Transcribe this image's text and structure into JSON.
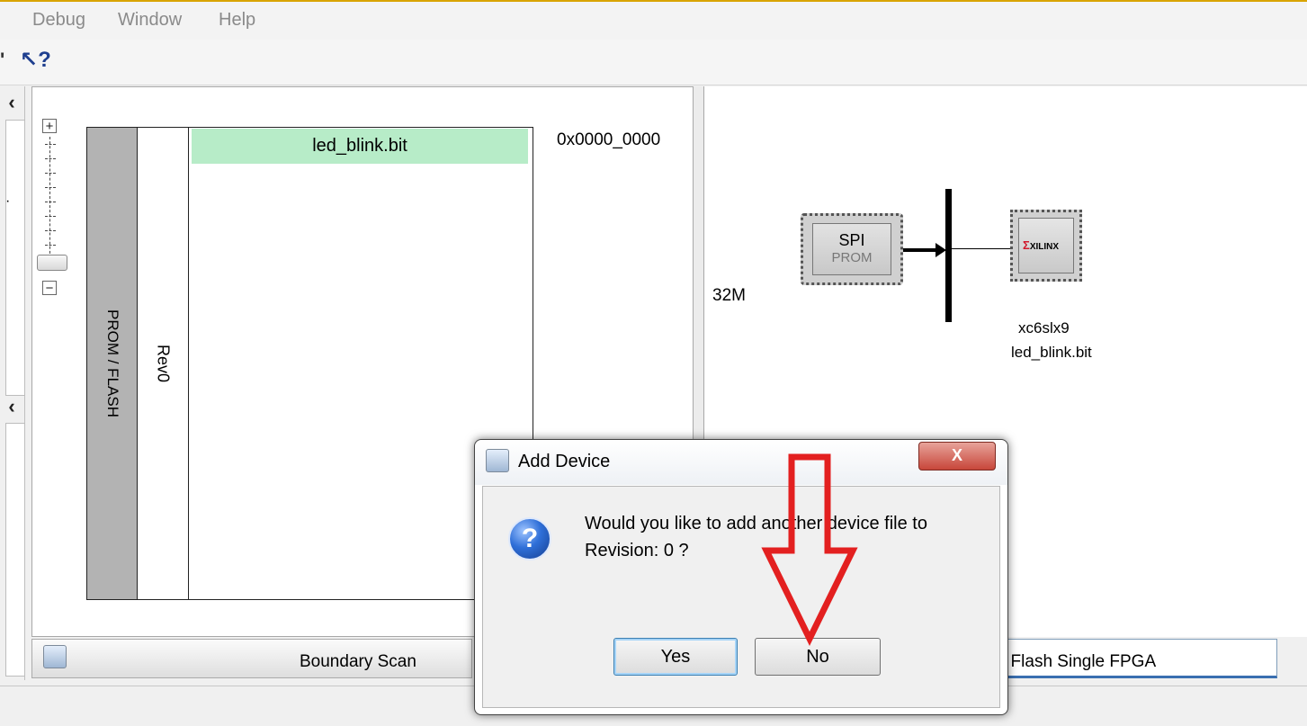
{
  "menu": [
    "Debug",
    "Window",
    "Help"
  ],
  "toolbar": {
    "help_cursor": "↖?"
  },
  "prom_panel": {
    "prom_label": "PROM / FLASH",
    "revision_label": "Rev0",
    "bit_file": "led_blink.bit",
    "start_address": "0x0000_0000"
  },
  "chain": {
    "prom_size": "32M",
    "spi_title": "SPI",
    "spi_subtitle": "PROM",
    "xilinx_logo": "XILINX",
    "fpga_part": "xc6slx9",
    "fpga_file": "led_blink.bit"
  },
  "tabs": {
    "left": "Boundary Scan",
    "right": "I Flash Single FPGA"
  },
  "dialog": {
    "title": "Add Device",
    "close": "X",
    "message_line1": "Would you like to add another device file to",
    "message_line2": "Revision: 0 ?",
    "yes": "Yes",
    "no": "No",
    "icon": "question-icon"
  },
  "colors": {
    "bit_block": "#b7ecc8",
    "annotation_arrow": "#e32020"
  }
}
